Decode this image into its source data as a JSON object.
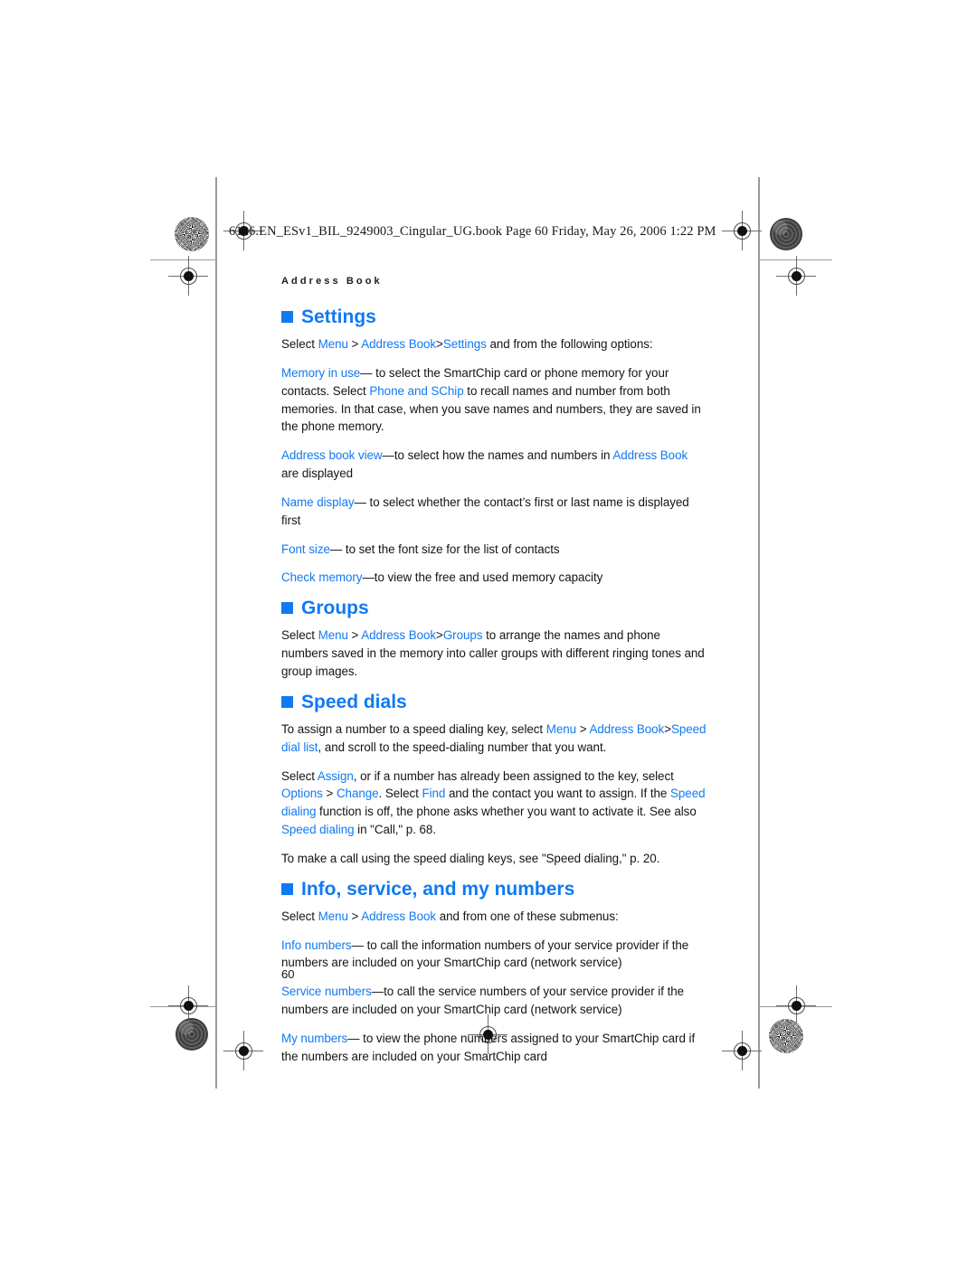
{
  "page": {
    "slug_line": "6126.EN_ESv1_BIL_9249003_Cingular_UG.book  Page 60  Friday, May 26, 2006  1:22 PM",
    "running_head": "Address Book",
    "folio": "60",
    "accent_color": "#1179f2",
    "text_color": "#141414"
  },
  "sections": [
    {
      "id": "settings",
      "heading": "Settings",
      "paragraphs": [
        {
          "id": "settings-intro",
          "runs": [
            {
              "t": "Select ",
              "c": "black"
            },
            {
              "t": "Menu",
              "c": "blue"
            },
            {
              "t": " > ",
              "c": "black"
            },
            {
              "t": "Address Book",
              "c": "blue"
            },
            {
              "t": ">",
              "c": "black"
            },
            {
              "t": "Settings",
              "c": "blue"
            },
            {
              "t": " and from the following options:",
              "c": "black"
            }
          ]
        },
        {
          "id": "memory-in-use",
          "runs": [
            {
              "t": "Memory in use",
              "c": "blue"
            },
            {
              "t": "—",
              "c": "black"
            },
            {
              "t": " to select the SmartChip card or phone memory for your contacts. Select ",
              "c": "black"
            },
            {
              "t": "Phone and SChip",
              "c": "blue"
            },
            {
              "t": " to",
              "c": "black"
            },
            {
              "t": " recall names and number from both memories. In that case, when you save names and numbers, they are saved in the phone memory.",
              "c": "black"
            }
          ]
        },
        {
          "id": "address-book-view",
          "runs": [
            {
              "t": "Address book view",
              "c": "blue"
            },
            {
              "t": "—",
              "c": "black"
            },
            {
              "t": "to select how the names and numbers in ",
              "c": "black"
            },
            {
              "t": "Address Book",
              "c": "blue"
            },
            {
              "t": " are displayed",
              "c": "black"
            }
          ]
        },
        {
          "id": "name-display",
          "runs": [
            {
              "t": "Name display",
              "c": "blue"
            },
            {
              "t": "—",
              "c": "black"
            },
            {
              "t": " to select whether the contact’s first or last name is displayed first",
              "c": "black"
            }
          ]
        },
        {
          "id": "font-size",
          "runs": [
            {
              "t": "Font size",
              "c": "blue"
            },
            {
              "t": "—",
              "c": "black"
            },
            {
              "t": " to set the font size for the list of contacts",
              "c": "black"
            }
          ]
        },
        {
          "id": "check-memory",
          "runs": [
            {
              "t": "Check memory",
              "c": "blue"
            },
            {
              "t": "—",
              "c": "black"
            },
            {
              "t": "to view the free and used memory capacity",
              "c": "black"
            }
          ]
        }
      ]
    },
    {
      "id": "groups",
      "heading": "Groups",
      "paragraphs": [
        {
          "id": "groups-intro",
          "runs": [
            {
              "t": "Select ",
              "c": "black"
            },
            {
              "t": "Menu",
              "c": "blue"
            },
            {
              "t": " > ",
              "c": "black"
            },
            {
              "t": "Address Book",
              "c": "blue"
            },
            {
              "t": ">",
              "c": "black"
            },
            {
              "t": "Groups",
              "c": "blue"
            },
            {
              "t": " to arrange the names and phone numbers saved in the memory into caller groups with different ringing tones and group images.",
              "c": "black"
            }
          ]
        }
      ]
    },
    {
      "id": "speed-dials",
      "heading": "Speed dials",
      "paragraphs": [
        {
          "id": "speed-dials-assign",
          "runs": [
            {
              "t": "To assign a number to a speed dialing key, select ",
              "c": "black"
            },
            {
              "t": "Menu",
              "c": "blue"
            },
            {
              "t": " > ",
              "c": "black"
            },
            {
              "t": "Address Book",
              "c": "blue"
            },
            {
              "t": ">",
              "c": "black"
            },
            {
              "t": "Speed dial list",
              "c": "blue"
            },
            {
              "t": ", and scroll to the speed-dialing number that you want.",
              "c": "black"
            }
          ]
        },
        {
          "id": "speed-dials-select",
          "runs": [
            {
              "t": "Select ",
              "c": "black"
            },
            {
              "t": "Assign",
              "c": "blue"
            },
            {
              "t": ", or if a number has already been assigned to the key, select ",
              "c": "black"
            },
            {
              "t": "Options",
              "c": "blue"
            },
            {
              "t": " > ",
              "c": "black"
            },
            {
              "t": "Change",
              "c": "blue"
            },
            {
              "t": ". Select ",
              "c": "black"
            },
            {
              "t": "Find",
              "c": "blue"
            },
            {
              "t": " and the contact you want to assign. If the ",
              "c": "black"
            },
            {
              "t": "Speed dialing",
              "c": "blue"
            },
            {
              "t": " function is off, the phone asks whether you want to activate it. See also ",
              "c": "black"
            },
            {
              "t": "Speed dialing",
              "c": "blue"
            },
            {
              "t": " in \"Call,\" p. 68.",
              "c": "black"
            }
          ]
        },
        {
          "id": "speed-dials-make-call",
          "runs": [
            {
              "t": "To make a call using the speed dialing keys, see \"Speed dialing,\" p. 20.",
              "c": "black"
            }
          ]
        }
      ]
    },
    {
      "id": "info-service-my-numbers",
      "heading": "Info, service, and my numbers",
      "paragraphs": [
        {
          "id": "info-intro",
          "runs": [
            {
              "t": "Select ",
              "c": "black"
            },
            {
              "t": "Menu",
              "c": "blue"
            },
            {
              "t": " > ",
              "c": "black"
            },
            {
              "t": "Address Book",
              "c": "blue"
            },
            {
              "t": " and from one of these submenus:",
              "c": "black"
            }
          ]
        },
        {
          "id": "info-numbers",
          "runs": [
            {
              "t": "Info numbers",
              "c": "blue"
            },
            {
              "t": "—",
              "c": "black"
            },
            {
              "t": " to call the information numbers of your service provider if the numbers are included on your SmartChip card (network service)",
              "c": "black"
            }
          ]
        },
        {
          "id": "service-numbers",
          "runs": [
            {
              "t": "Service numbers",
              "c": "blue"
            },
            {
              "t": "—",
              "c": "black"
            },
            {
              "t": "to call the service numbers of your service provider if the numbers are included on your SmartChip card (network service)",
              "c": "black"
            }
          ]
        },
        {
          "id": "my-numbers",
          "runs": [
            {
              "t": "My numbers",
              "c": "blue"
            },
            {
              "t": "—",
              "c": "black"
            },
            {
              "t": " to view the phone numbers assigned to your SmartChip card if the numbers are included on your SmartChip card",
              "c": "black"
            }
          ]
        }
      ]
    }
  ]
}
